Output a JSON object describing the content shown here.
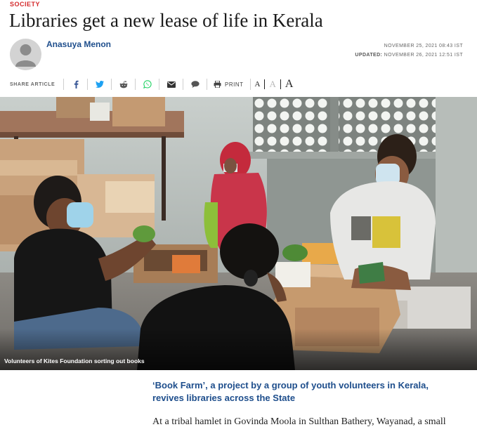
{
  "article": {
    "section": "SOCIETY",
    "title": "Libraries get a new lease of life in Kerala",
    "author": "Anasuya Menon",
    "published": "NOVEMBER 25, 2021 08:43 IST",
    "updated_label": "UPDATED:",
    "updated": "NOVEMBER 26, 2021 12:51 IST",
    "image_caption": "Volunteers of Kites Foundation sorting out books",
    "subtitle": "‘Book Farm’, a project by a group of youth volunteers in Kerala, revives libraries across the State",
    "body_start": "At a tribal hamlet in Govinda Moola in Sulthan Bathery, Wayanad, a small"
  },
  "share_bar": {
    "label": "SHARE ARTICLE",
    "icons": [
      "facebook-icon",
      "twitter-icon",
      "reddit-icon",
      "whatsapp-icon",
      "email-icon",
      "comment-icon"
    ],
    "print_label": "PRINT",
    "font_sizes": [
      "A",
      "A",
      "A"
    ]
  },
  "colors": {
    "section": "#d4292b",
    "author": "#1e4e8c",
    "subtitle": "#1e4e8c",
    "facebook": "#3b5998",
    "twitter": "#1da1f2",
    "whatsapp": "#25d366"
  }
}
